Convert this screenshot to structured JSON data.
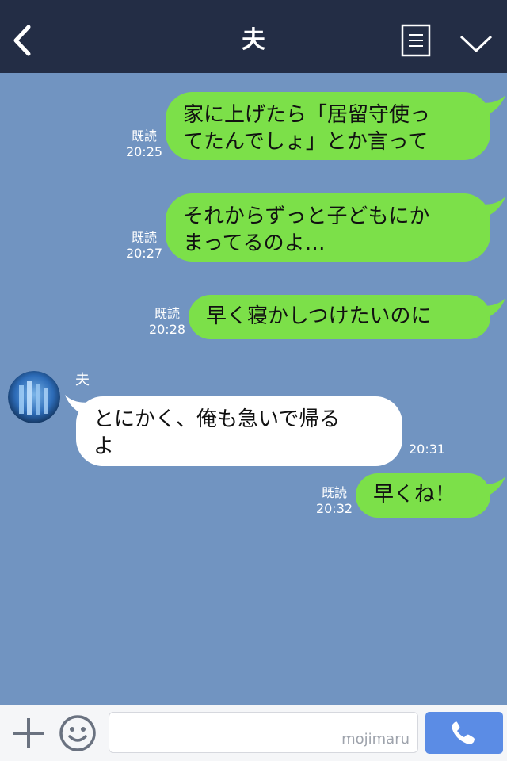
{
  "header": {
    "title": "夫",
    "icons": [
      "back-arrow-icon",
      "menu-list-icon",
      "chevron-down-icon"
    ],
    "background": "#232d45"
  },
  "chat": {
    "background": "#7194c1",
    "messages": [
      {
        "direction": "outgoing",
        "text": "家に上げたら「居留守使っ\nてたんでしょ」とか言って",
        "read": "既読",
        "time": "20:25"
      },
      {
        "direction": "outgoing",
        "text": "それからずっと子どもにか\nまってるのよ…",
        "read": "既読",
        "time": "20:27"
      },
      {
        "direction": "outgoing",
        "text": "早く寝かしつけたいのに",
        "read": "既読",
        "time": "20:28"
      },
      {
        "direction": "incoming",
        "sender": "夫",
        "text": "とにかく、俺も急いで帰る\nよ",
        "time": "20:31"
      },
      {
        "direction": "outgoing",
        "text": "早くね！",
        "read": "既読",
        "time": "20:32"
      }
    ],
    "outgoing_bubble_color": "#7ce049",
    "incoming_bubble_color": "#ffffff"
  },
  "footer": {
    "icons": [
      "plus-icon",
      "emoji-icon",
      "phone-icon"
    ],
    "input_value": "",
    "watermark": "mojimaru",
    "call_button_color": "#5b8ce5"
  }
}
